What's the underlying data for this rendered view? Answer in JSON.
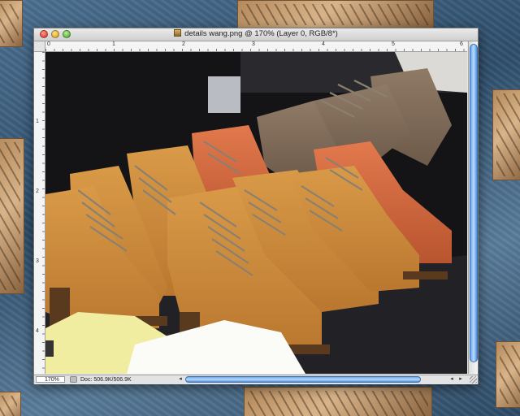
{
  "window": {
    "title": "details wang.png @ 170% (Layer 0, RGB/8*)"
  },
  "rulers": {
    "top": [
      "0",
      "1",
      "2",
      "3",
      "4",
      "5",
      "6"
    ],
    "left": [
      "1",
      "2",
      "3",
      "4"
    ]
  },
  "status": {
    "zoom": "170%",
    "doc": "Doc: 506.9K/506.9K"
  },
  "icons": {
    "close": "close-button-icon",
    "minimize": "minimize-button-icon",
    "zoom": "zoom-button-icon",
    "file": "png-file-icon",
    "left": "scroll-left-arrow-icon",
    "right": "scroll-right-arrow-icon",
    "resize": "resize-grip-icon"
  },
  "colors": {
    "scroll_thumb": "#6aa6e8",
    "close": "#d5261b",
    "minimize": "#d49a10",
    "zoom": "#3e9d1c"
  }
}
